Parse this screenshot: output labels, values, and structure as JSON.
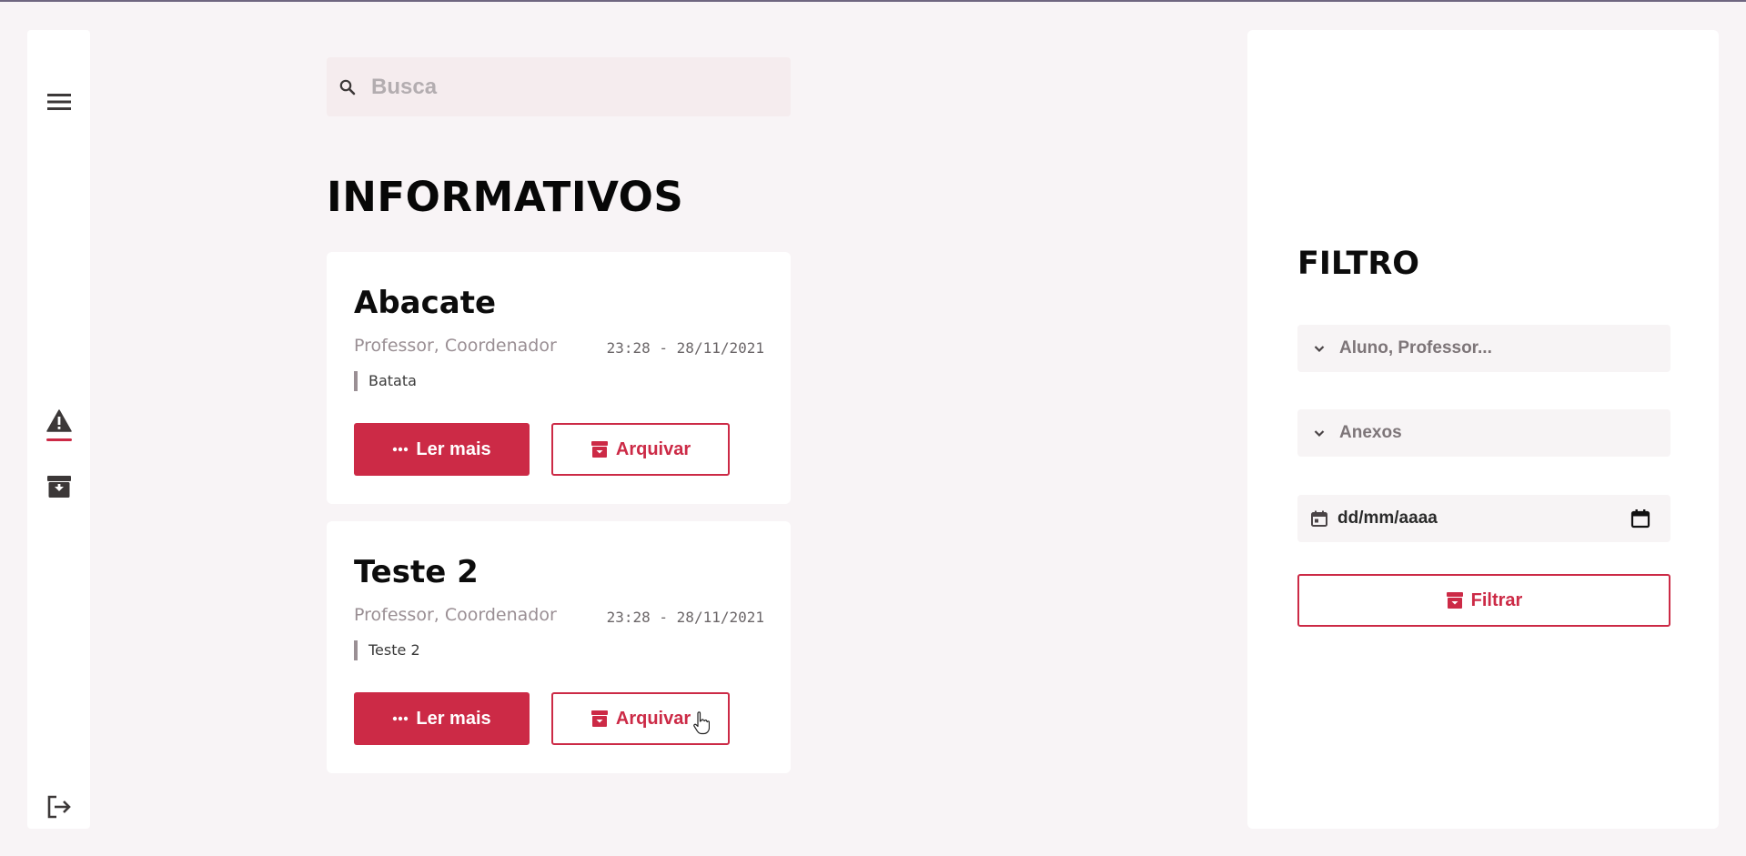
{
  "colors": {
    "accent": "#cc2a46",
    "background": "#f8f4f6",
    "panel": "#ffffff"
  },
  "sidebar": {
    "items": [
      {
        "icon": "menu-icon"
      },
      {
        "icon": "alert-triangle-icon",
        "active": true
      },
      {
        "icon": "archive-box-icon"
      },
      {
        "icon": "logout-icon"
      }
    ]
  },
  "search": {
    "placeholder": "Busca",
    "value": ""
  },
  "main": {
    "title": "INFORMATIVOS",
    "cards": [
      {
        "title": "Abacate",
        "roles": "Professor, Coordenador",
        "datetime": "23:28 - 28/11/2021",
        "description": "Batata",
        "read_more_label": "Ler mais",
        "archive_label": "Arquivar"
      },
      {
        "title": "Teste 2",
        "roles": "Professor, Coordenador",
        "datetime": "23:28 - 28/11/2021",
        "description": "Teste 2",
        "read_more_label": "Ler mais",
        "archive_label": "Arquivar"
      }
    ]
  },
  "filter": {
    "title": "FILTRO",
    "audience_placeholder": "Aluno, Professor...",
    "attachments_label": "Anexos",
    "date_placeholder": "dd/mm/aaaa",
    "submit_label": "Filtrar"
  }
}
